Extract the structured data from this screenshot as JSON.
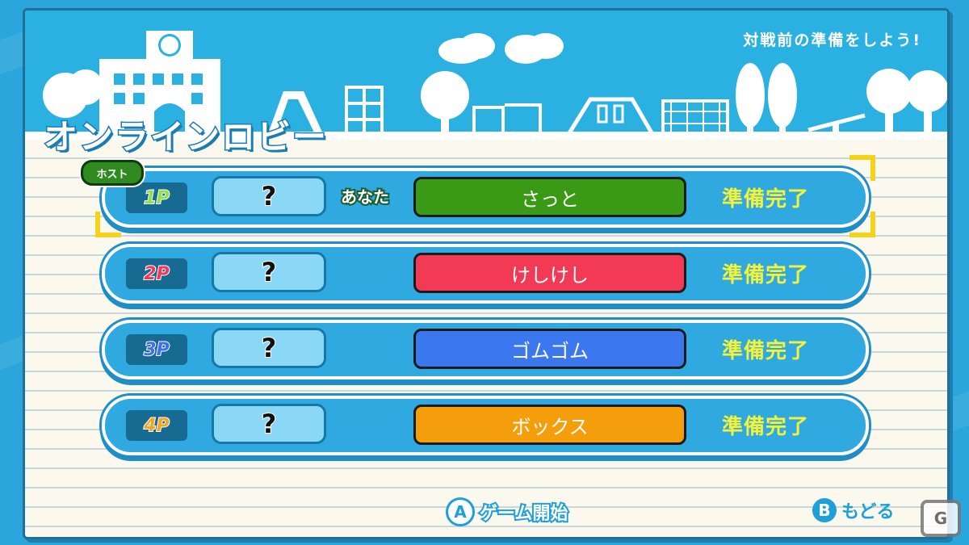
{
  "header": {
    "subtitle": "対戦前の準備をしよう!"
  },
  "title": "オンラインロビー",
  "host_label": "ホスト",
  "you_label": "あなた",
  "players": [
    {
      "slot": "1P",
      "slot_color": "#8fe04a",
      "avatar": "?",
      "name": "さっと",
      "name_color": "#3a9a16",
      "status": "準備完了"
    },
    {
      "slot": "2P",
      "slot_color": "#f2395c",
      "avatar": "?",
      "name": "けしけし",
      "name_color": "#f23a55",
      "status": "準備完了"
    },
    {
      "slot": "3P",
      "slot_color": "#3d6ff2",
      "avatar": "?",
      "name": "ゴムゴム",
      "name_color": "#3b78f0",
      "status": "準備完了"
    },
    {
      "slot": "4P",
      "slot_color": "#f5a521",
      "avatar": "?",
      "name": "ボックス",
      "name_color": "#f59e0b",
      "status": "準備完了"
    }
  ],
  "footer": {
    "a_button": "A",
    "a_label": "ゲーム開始",
    "b_button": "B",
    "b_label": "もどる"
  },
  "colors": {
    "background": "#2aa6dc",
    "ready": "#f4f33a",
    "accent": "#1e9fd8"
  },
  "logo_text": "G"
}
